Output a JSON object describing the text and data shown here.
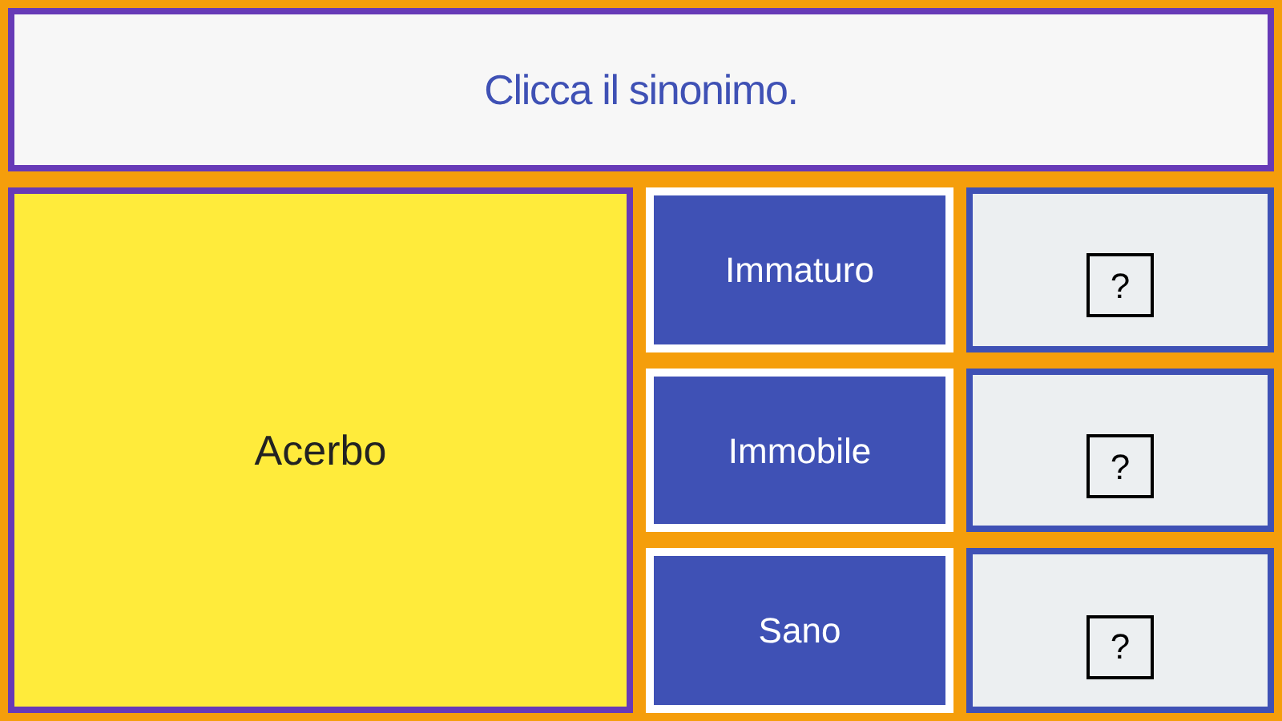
{
  "prompt": "Clicca il sinonimo.",
  "word": "Acerbo",
  "options": [
    {
      "label": "Immaturo",
      "slot": "?"
    },
    {
      "label": "Immobile",
      "slot": "?"
    },
    {
      "label": "Sano",
      "slot": "?"
    }
  ]
}
